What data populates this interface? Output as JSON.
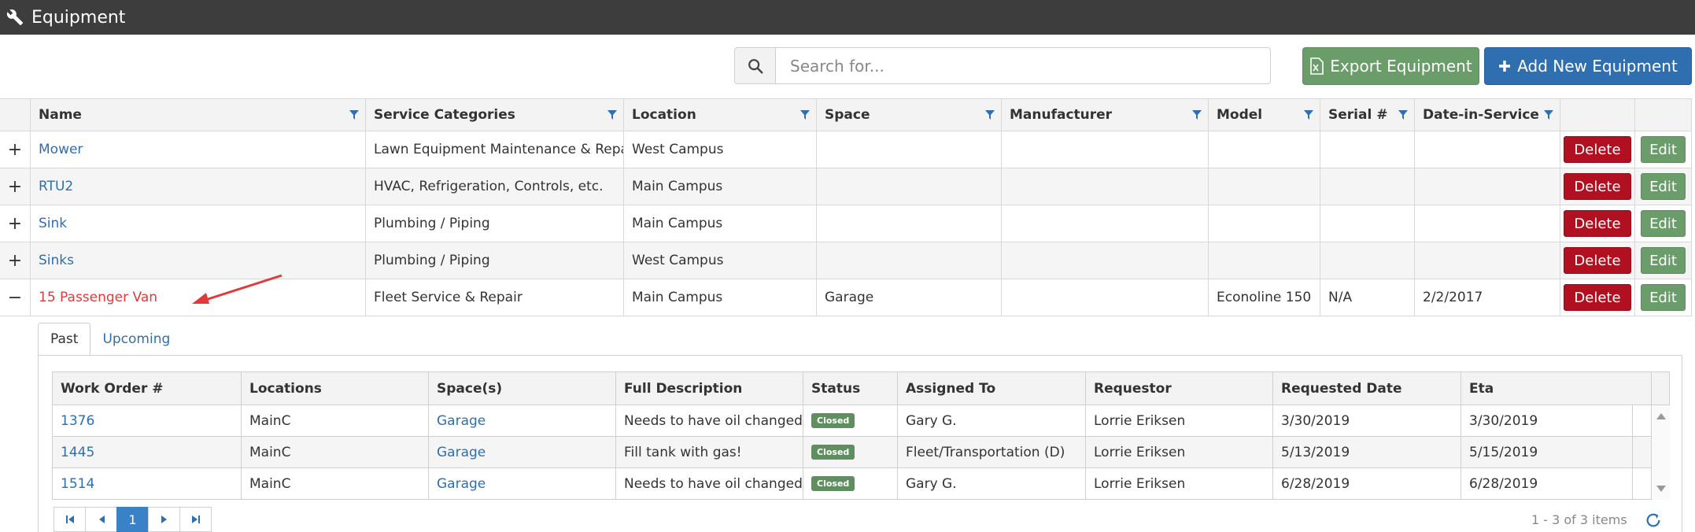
{
  "header": {
    "title": "Equipment",
    "icon": "wrench-icon"
  },
  "toolbar": {
    "search_placeholder": "Search for...",
    "export_label": "Export Equipment",
    "add_label": "Add New Equipment"
  },
  "grid": {
    "columns": [
      "Name",
      "Service Categories",
      "Location",
      "Space",
      "Manufacturer",
      "Model",
      "Serial #",
      "Date-in-Service"
    ],
    "rows": [
      {
        "expander": "+",
        "name": "Mower",
        "service": "Lawn Equipment Maintenance & Repair",
        "location": "West Campus",
        "space": "",
        "manufacturer": "",
        "model": "",
        "serial": "",
        "date": "",
        "delete": "Delete",
        "edit": "Edit"
      },
      {
        "expander": "+",
        "name": "RTU2",
        "service": "HVAC, Refrigeration, Controls, etc.",
        "location": "Main Campus",
        "space": "",
        "manufacturer": "",
        "model": "",
        "serial": "",
        "date": "",
        "delete": "Delete",
        "edit": "Edit"
      },
      {
        "expander": "+",
        "name": "Sink",
        "service": "Plumbing / Piping",
        "location": "Main Campus",
        "space": "",
        "manufacturer": "",
        "model": "",
        "serial": "",
        "date": "",
        "delete": "Delete",
        "edit": "Edit"
      },
      {
        "expander": "+",
        "name": "Sinks",
        "service": "Plumbing / Piping",
        "location": "West Campus",
        "space": "",
        "manufacturer": "",
        "model": "",
        "serial": "",
        "date": "",
        "delete": "Delete",
        "edit": "Edit"
      },
      {
        "expander": "−",
        "name": "15 Passenger Van",
        "service": "Fleet Service & Repair",
        "location": "Main Campus",
        "space": "Garage",
        "manufacturer": "",
        "model": "Econoline 150",
        "serial": "N/A",
        "date": "2/2/2017",
        "delete": "Delete",
        "edit": "Edit"
      }
    ]
  },
  "detail": {
    "tabs": [
      "Past",
      "Upcoming"
    ],
    "columns": [
      "Work Order #",
      "Locations",
      "Space(s)",
      "Full Description",
      "Status",
      "Assigned To",
      "Requestor",
      "Requested Date",
      "Eta"
    ],
    "rows": [
      {
        "wo": "1376",
        "location": "MainC",
        "space": "Garage",
        "description": "Needs to have oil changed.",
        "status": "Closed",
        "assigned": "Gary G.",
        "requestor": "Lorrie Eriksen",
        "requested": "3/30/2019",
        "eta": "3/30/2019"
      },
      {
        "wo": "1445",
        "location": "MainC",
        "space": "Garage",
        "description": "Fill tank with gas!",
        "status": "Closed",
        "assigned": "Fleet/Transportation (D)",
        "requestor": "Lorrie Eriksen",
        "requested": "5/13/2019",
        "eta": "5/15/2019"
      },
      {
        "wo": "1514",
        "location": "MainC",
        "space": "Garage",
        "description": "Needs to have oil changed.",
        "status": "Closed",
        "assigned": "Gary G.",
        "requestor": "Lorrie Eriksen",
        "requested": "6/28/2019",
        "eta": "6/28/2019"
      }
    ],
    "pager": {
      "current_page": "1",
      "info": "1 - 3 of 3 items"
    }
  },
  "colors": {
    "header_bg": "#3d3d3d",
    "link": "#2f6fb0",
    "delete": "#b0101f",
    "edit": "#6a9d6a",
    "add": "#2f6fb0",
    "expanded_name": "#e03a3a"
  }
}
